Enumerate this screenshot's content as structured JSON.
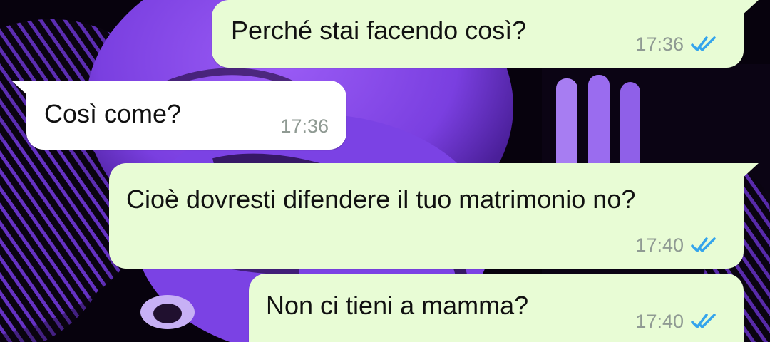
{
  "colors": {
    "outgoing_bubble": "#e8fcd5",
    "incoming_bubble": "#ffffff",
    "timestamp": "#8f9a93",
    "read_ticks": "#34a4ec",
    "wallpaper_accent": "#8a4df0"
  },
  "messages": [
    {
      "direction": "outgoing",
      "text": "Perché stai facendo così?",
      "time": "17:36",
      "status_icon": "double-check-read-icon"
    },
    {
      "direction": "incoming",
      "text": "Così come?",
      "time": "17:36"
    },
    {
      "direction": "outgoing",
      "text": "Cioè dovresti difendere il tuo matrimonio no?",
      "time": "17:40",
      "status_icon": "double-check-read-icon"
    },
    {
      "direction": "outgoing",
      "text": "Non ci tieni a mamma?",
      "time": "17:40",
      "status_icon": "double-check-read-icon"
    }
  ]
}
